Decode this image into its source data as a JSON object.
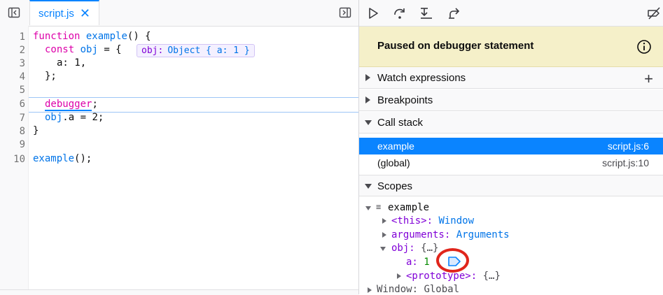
{
  "editor": {
    "tab_name": "script.js",
    "tab_close": "✕",
    "line_numbers": [
      "1",
      "2",
      "3",
      "4",
      "5",
      "6",
      "7",
      "8",
      "9",
      "10"
    ],
    "lines": {
      "l1": {
        "kw": "function",
        "name": "example",
        "rest": "() {"
      },
      "l2": {
        "kw": "const",
        "name": "obj",
        "rest": " = {"
      },
      "l3": {
        "text": "a: 1,"
      },
      "l4": {
        "text": "};"
      },
      "l6": {
        "kw": "debugger",
        "rest": ";"
      },
      "l7": {
        "obj": "obj",
        "rest": ".a = 2;"
      },
      "l8": {
        "text": "}"
      },
      "l10": {
        "name": "example",
        "rest": "();"
      }
    },
    "inline_preview": {
      "key": "obj:",
      "value": "Object { a: 1 }"
    }
  },
  "sidebar": {
    "banner": {
      "title": "Paused on debugger statement"
    },
    "sections": {
      "watch": "Watch expressions",
      "breakpoints": "Breakpoints",
      "call_stack": "Call stack",
      "scopes": "Scopes"
    },
    "call_stack": [
      {
        "name": "example",
        "location": "script.js:6"
      },
      {
        "name": "(global)",
        "location": "script.js:10"
      }
    ],
    "scopes": {
      "root": "example",
      "this_key": "<this>:",
      "this_val": "Window",
      "args_key": "arguments:",
      "args_val": "Arguments",
      "obj_key": "obj:",
      "obj_val": "{…}",
      "a_key": "a:",
      "a_val": "1",
      "proto_key": "<prototype>:",
      "proto_val": "{…}",
      "window_key": "Window:",
      "window_val": "Global"
    }
  },
  "colors": {
    "accent": "#0a84ff",
    "banner": "#f5f0c9",
    "highlight": "#e0251b"
  }
}
